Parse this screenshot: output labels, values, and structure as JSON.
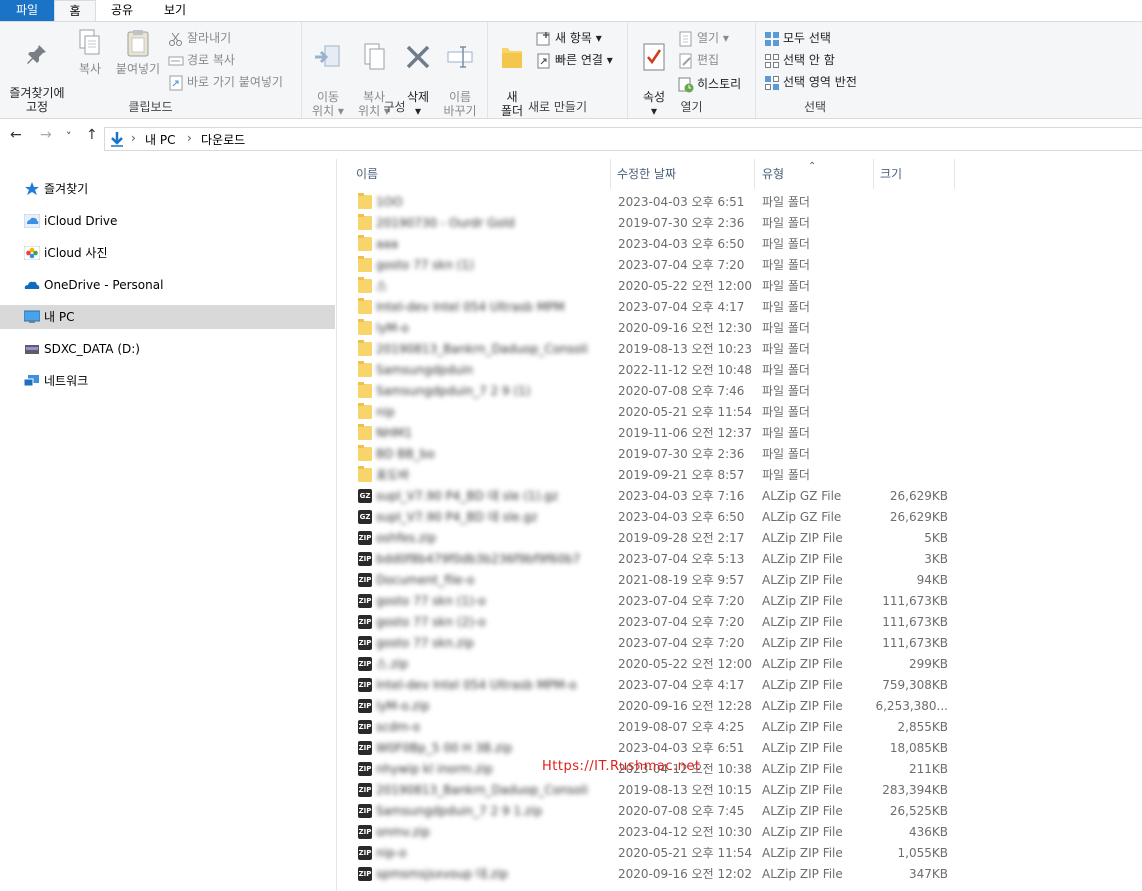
{
  "tabs": [
    "파일",
    "홈",
    "공유",
    "보기"
  ],
  "ribbon": {
    "clipboard": {
      "label": "클립보드",
      "pin": "즐겨찾기에\n고정",
      "copy": "복사",
      "paste": "붙여넣기",
      "cut": "잘라내기",
      "copy_path": "경로 복사",
      "paste_shortcut": "바로 가기 붙여넣기"
    },
    "organize": {
      "label": "구성",
      "move": "이동\n위치 ▾",
      "copyto": "복사\n위치 ▾",
      "delete": "삭제\n▾",
      "rename": "이름\n바꾸기"
    },
    "new": {
      "label": "새로 만들기",
      "new_folder": "새\n폴더",
      "new_item": "새 항목 ▾",
      "easy_access": "빠른 연결 ▾"
    },
    "open": {
      "label": "열기",
      "properties": "속성\n▾",
      "open": "열기 ▾",
      "edit": "편집",
      "history": "히스토리"
    },
    "select": {
      "label": "선택",
      "all": "모두 선택",
      "none": "선택 안 함",
      "invert": "선택 영역 반전"
    }
  },
  "nav": {
    "back": "←",
    "forward": "→",
    "recent": "˅",
    "up": "↑"
  },
  "breadcrumb": [
    "내 PC",
    "다운로드"
  ],
  "sidebar": [
    {
      "label": "즐겨찾기",
      "icon": "star-icon"
    },
    {
      "label": "iCloud Drive",
      "icon": "icloud-icon"
    },
    {
      "label": "iCloud 사진",
      "icon": "photos-icon"
    },
    {
      "label": "OneDrive - Personal",
      "icon": "onedrive-icon"
    },
    {
      "label": "내 PC",
      "icon": "pc-icon",
      "selected": true
    },
    {
      "label": "SDXC_DATA (D:)",
      "icon": "sdcard-icon"
    },
    {
      "label": "네트워크",
      "icon": "network-icon"
    }
  ],
  "columns": {
    "name": "이름",
    "date": "수정한 날짜",
    "type": "유형",
    "size": "크기"
  },
  "files": [
    {
      "name": "1OO",
      "date": "2023-04-03 오후 6:51",
      "type": "파일 폴더",
      "size": "",
      "kind": "folder"
    },
    {
      "name": "20190730 - Ourdr Gold",
      "date": "2019-07-30 오후 2:36",
      "type": "파일 폴더",
      "size": "",
      "kind": "folder"
    },
    {
      "name": "ааа",
      "date": "2023-04-03 오후 6:50",
      "type": "파일 폴더",
      "size": "",
      "kind": "folder"
    },
    {
      "name": "gosto 77 skn (1)",
      "date": "2023-07-04 오후 7:20",
      "type": "파일 폴더",
      "size": "",
      "kind": "folder"
    },
    {
      "name": "스",
      "date": "2020-05-22 오전 12:00",
      "type": "파일 폴더",
      "size": "",
      "kind": "folder"
    },
    {
      "name": "Intel-dev Intel 054 Ultrasb MPM",
      "date": "2023-07-04 오후 4:17",
      "type": "파일 폴더",
      "size": "",
      "kind": "folder"
    },
    {
      "name": "lyM-o",
      "date": "2020-09-16 오전 12:30",
      "type": "파일 폴더",
      "size": "",
      "kind": "folder"
    },
    {
      "name": "20190813_Bankrn_Daduop_Consoli",
      "date": "2019-08-13 오전 10:23",
      "type": "파일 폴더",
      "size": "",
      "kind": "folder"
    },
    {
      "name": "Samsungdpduin",
      "date": "2022-11-12 오전 10:48",
      "type": "파일 폴더",
      "size": "",
      "kind": "folder"
    },
    {
      "name": "Samsungdpduin_7 2 9 (1)",
      "date": "2020-07-08 오후 7:46",
      "type": "파일 폴더",
      "size": "",
      "kind": "folder"
    },
    {
      "name": "nip",
      "date": "2020-05-21 오후 11:54",
      "type": "파일 폴더",
      "size": "",
      "kind": "folder"
    },
    {
      "name": "NHM1",
      "date": "2019-11-06 오전 12:37",
      "type": "파일 폴더",
      "size": "",
      "kind": "folder"
    },
    {
      "name": "BD BB_bo",
      "date": "2019-07-30 오후 2:36",
      "type": "파일 폴더",
      "size": "",
      "kind": "folder"
    },
    {
      "name": "표도바",
      "date": "2019-09-21 오후 8:57",
      "type": "파일 폴더",
      "size": "",
      "kind": "folder"
    },
    {
      "name": "supl_V7.90 P4_BD 데 sle (1).gz",
      "date": "2023-04-03 오후 7:16",
      "type": "ALZip GZ File",
      "size": "26,629KB",
      "kind": "gz"
    },
    {
      "name": "supl_V7.90 P4_BD 데 sle.gz",
      "date": "2023-04-03 오후 6:50",
      "type": "ALZip GZ File",
      "size": "26,629KB",
      "kind": "gz"
    },
    {
      "name": "oshfes.zip",
      "date": "2019-09-28 오전 2:17",
      "type": "ALZip ZIP File",
      "size": "5KB",
      "kind": "zip"
    },
    {
      "name": "bdd0f8b479f0db3b236f9bf9f60b7",
      "date": "2023-07-04 오후 5:13",
      "type": "ALZip ZIP File",
      "size": "3KB",
      "kind": "zip"
    },
    {
      "name": "Document_file-o",
      "date": "2021-08-19 오후 9:57",
      "type": "ALZip ZIP File",
      "size": "94KB",
      "kind": "zip"
    },
    {
      "name": "gosto 77 skn (1)-o",
      "date": "2023-07-04 오후 7:20",
      "type": "ALZip ZIP File",
      "size": "111,673KB",
      "kind": "zip"
    },
    {
      "name": "gosto 77 skn (2)-o",
      "date": "2023-07-04 오후 7:20",
      "type": "ALZip ZIP File",
      "size": "111,673KB",
      "kind": "zip"
    },
    {
      "name": "gosto 77 skn.zip",
      "date": "2023-07-04 오후 7:20",
      "type": "ALZip ZIP File",
      "size": "111,673KB",
      "kind": "zip"
    },
    {
      "name": "스.zip",
      "date": "2020-05-22 오전 12:00",
      "type": "ALZip ZIP File",
      "size": "299KB",
      "kind": "zip"
    },
    {
      "name": "Intel-dev Intel 054 Ultrasb MPM-o",
      "date": "2023-07-04 오후 4:17",
      "type": "ALZip ZIP File",
      "size": "759,308KB",
      "kind": "zip"
    },
    {
      "name": "lyM-o.zip",
      "date": "2020-09-16 오전 12:28",
      "type": "ALZip ZIP File",
      "size": "6,253,380...",
      "kind": "zip"
    },
    {
      "name": "scdm-o",
      "date": "2019-08-07 오후 4:25",
      "type": "ALZip ZIP File",
      "size": "2,855KB",
      "kind": "zip"
    },
    {
      "name": "W0F0Bp_5 00 H 3B.zip",
      "date": "2023-04-03 오후 6:51",
      "type": "ALZip ZIP File",
      "size": "18,085KB",
      "kind": "zip"
    },
    {
      "name": "nhywip kl inorm.zip",
      "date": "2023-04-12 오전 10:38",
      "type": "ALZip ZIP File",
      "size": "211KB",
      "kind": "zip"
    },
    {
      "name": "20190813_Bankrn_Daduop_Consoli",
      "date": "2019-08-13 오전 10:15",
      "type": "ALZip ZIP File",
      "size": "283,394KB",
      "kind": "zip"
    },
    {
      "name": "Samsungdpduin_7 2 9 1.zip",
      "date": "2020-07-08 오후 7:45",
      "type": "ALZip ZIP File",
      "size": "26,525KB",
      "kind": "zip"
    },
    {
      "name": "onmv.zip",
      "date": "2023-04-12 오전 10:30",
      "type": "ALZip ZIP File",
      "size": "436KB",
      "kind": "zip"
    },
    {
      "name": "nip-o",
      "date": "2020-05-21 오후 11:54",
      "type": "ALZip ZIP File",
      "size": "1,055KB",
      "kind": "zip"
    },
    {
      "name": "spmsmsjsxvoup 대.zip",
      "date": "2020-09-16 오전 12:02",
      "type": "ALZip ZIP File",
      "size": "347KB",
      "kind": "zip"
    }
  ],
  "watermark": "Https://IT.Rushmac.net",
  "colors": {
    "file_tab": "#1a73c7",
    "selected_nav": "#d9d9d9",
    "folder": "#f8d56b",
    "watermark": "#e0201c"
  }
}
